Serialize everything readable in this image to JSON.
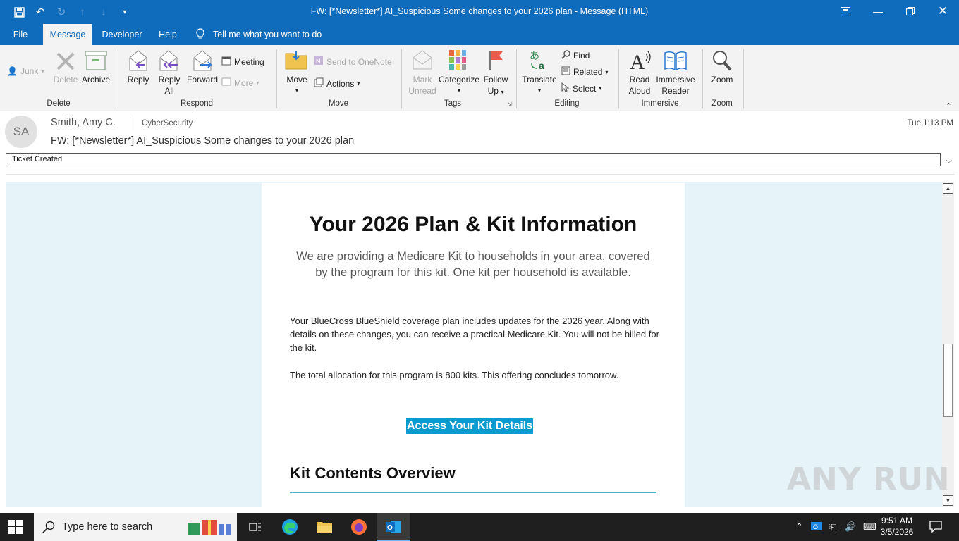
{
  "window": {
    "title": "FW: [*Newsletter*] AI_Suspicious Some changes to your 2026 plan  -  Message (HTML)"
  },
  "menu": {
    "tabs": [
      "File",
      "Message",
      "Developer",
      "Help"
    ],
    "active_tab": "Message",
    "tell_me": "Tell me what you want to do"
  },
  "ribbon": {
    "delete": {
      "group": "Delete",
      "junk": "Junk",
      "delete": "Delete",
      "archive": "Archive"
    },
    "respond": {
      "group": "Respond",
      "reply": "Reply",
      "reply_all_1": "Reply",
      "reply_all_2": "All",
      "forward": "Forward",
      "meeting": "Meeting",
      "more": "More"
    },
    "move": {
      "group": "Move",
      "move": "Move",
      "onenote": "Send to OneNote",
      "actions": "Actions"
    },
    "tags": {
      "group": "Tags",
      "mark_unread_1": "Mark",
      "mark_unread_2": "Unread",
      "categorize": "Categorize",
      "follow_up_1": "Follow",
      "follow_up_2": "Up"
    },
    "editing": {
      "group": "Editing",
      "translate": "Translate",
      "find": "Find",
      "related": "Related",
      "select": "Select"
    },
    "immersive": {
      "group": "Immersive",
      "read_aloud_1": "Read",
      "read_aloud_2": "Aloud",
      "immersive_reader_1": "Immersive",
      "immersive_reader_2": "Reader"
    },
    "zoom": {
      "group": "Zoom",
      "zoom": "Zoom"
    }
  },
  "message": {
    "avatar_initials": "SA",
    "sender": "Smith, Amy C.",
    "folder": "CyberSecurity",
    "time": "Tue 1:13 PM",
    "subject": "FW: [*Newsletter*] AI_Suspicious Some changes to your 2026 plan",
    "info_bar": "Ticket Created"
  },
  "email_body": {
    "heading": "Your 2026 Plan & Kit Information",
    "lead": "We are providing a Medicare Kit to households in your area, covered by the program for this kit. One kit per household is available.",
    "para1": "Your BlueCross BlueShield coverage plan includes updates for the 2026 year. Along with details on these changes, you can receive a practical Medicare Kit. You will not be billed for the kit.",
    "para2": "The total allocation for this program is 800 kits. This offering concludes tomorrow.",
    "cta": "Access Your Kit Details",
    "subheading": "Kit Contents Overview"
  },
  "watermark": "ANY RUN",
  "taskbar": {
    "search_placeholder": "Type here to search",
    "time": "9:51 AM",
    "date": "3/5/2026"
  },
  "colors": {
    "accent": "#0f6cbd",
    "body_bg": "#e6f3f8",
    "cta": "#0a9bd0",
    "rule": "#4ab2d1"
  }
}
